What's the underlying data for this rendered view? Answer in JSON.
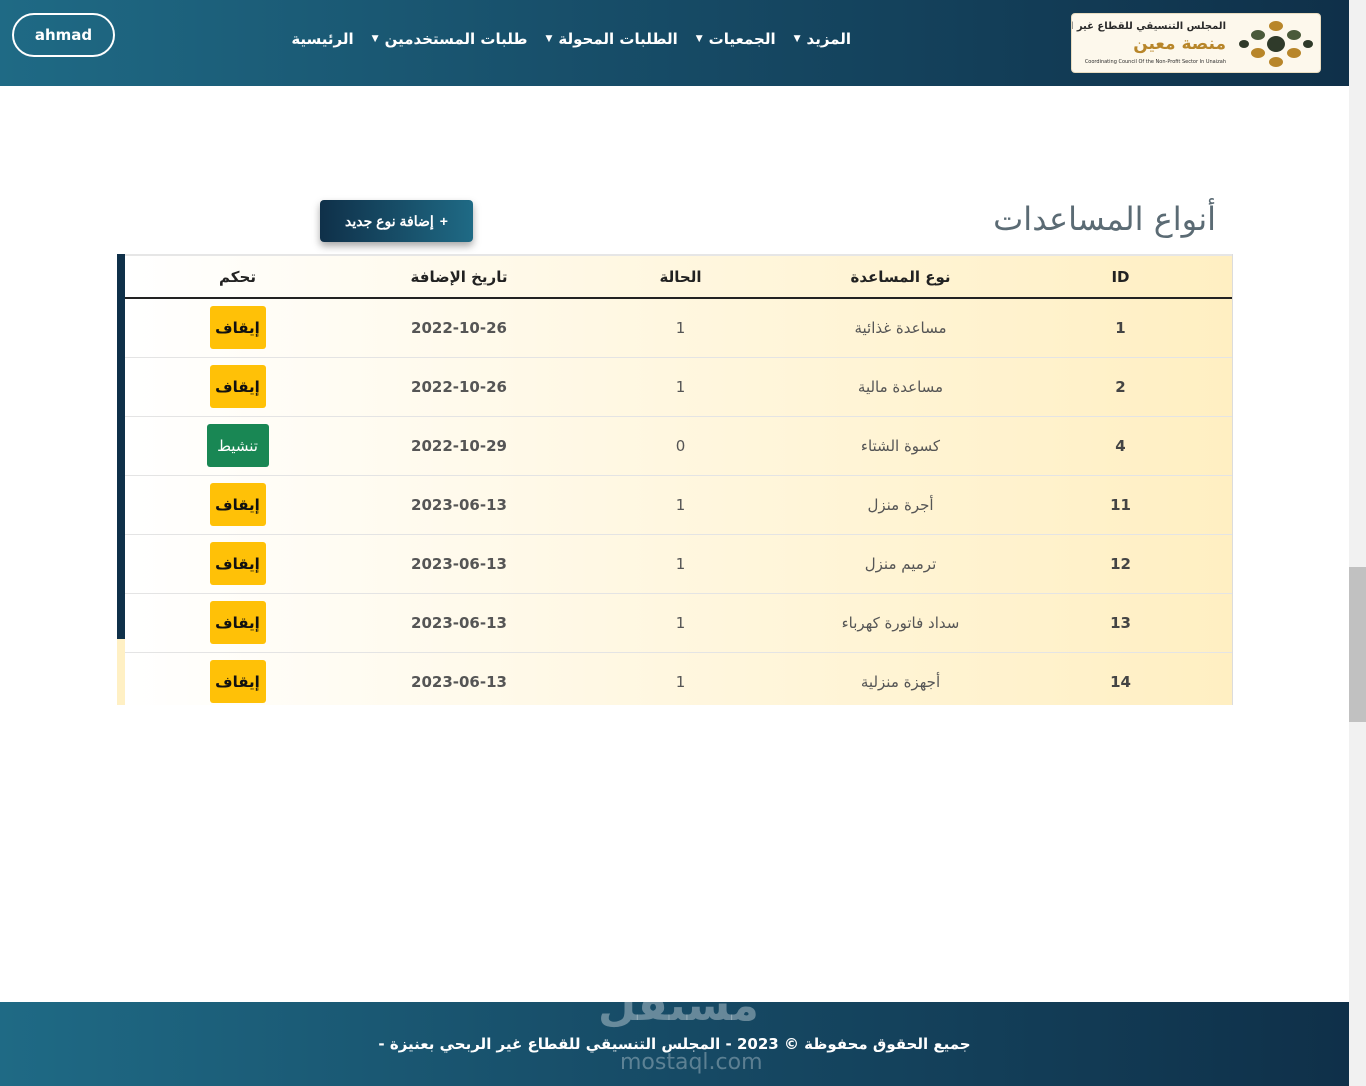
{
  "header": {
    "user_label": "ahmad",
    "nav": [
      {
        "label": "الرئيسية",
        "dropdown": false
      },
      {
        "label": "طلبات المستخدمين",
        "dropdown": true
      },
      {
        "label": "الطلبات المحولة",
        "dropdown": true
      },
      {
        "label": "الجمعيات",
        "dropdown": true
      },
      {
        "label": "المزيد",
        "dropdown": true
      }
    ],
    "logo": {
      "line1": "المجلس التنسيقي للقطاع غير الربحي بعنيزة",
      "line2": "منصة معين",
      "line3": "Coordinating Council Of the Non-Profit Sector In Unaizah"
    }
  },
  "page": {
    "title": "أنواع المساعدات",
    "add_button_icon": "+",
    "add_button_label": "إضافة نوع جديد"
  },
  "table": {
    "headers": {
      "id": "ID",
      "type": "نوع المساعدة",
      "status": "الحالة",
      "date": "تاريخ الإضافة",
      "control": "تحكم"
    },
    "rows": [
      {
        "id": "1",
        "type": "مساعدة غذائية",
        "status": "1",
        "date": "2022-10-26",
        "action": "إيقاف"
      },
      {
        "id": "2",
        "type": "مساعدة مالية",
        "status": "1",
        "date": "2022-10-26",
        "action": "إيقاف"
      },
      {
        "id": "4",
        "type": "كسوة الشتاء",
        "status": "0",
        "date": "2022-10-29",
        "action": "تنشيط"
      },
      {
        "id": "11",
        "type": "أجرة منزل",
        "status": "1",
        "date": "2023-06-13",
        "action": "إيقاف"
      },
      {
        "id": "12",
        "type": "ترميم منزل",
        "status": "1",
        "date": "2023-06-13",
        "action": "إيقاف"
      },
      {
        "id": "13",
        "type": "سداد فاتورة كهرباء",
        "status": "1",
        "date": "2023-06-13",
        "action": "إيقاف"
      },
      {
        "id": "14",
        "type": "أجهزة منزلية",
        "status": "1",
        "date": "2023-06-13",
        "action": "إيقاف"
      }
    ]
  },
  "footer": {
    "text": "جميع الحقوق محفوظة © 2023 - المجلس التنسيقي للقطاع غير الربحي بعنيزة -",
    "watermark": "مستقل",
    "watermark_sub": "mostaql.com"
  },
  "colors": {
    "header_dark": "#0f3049",
    "header_light": "#1f6a85",
    "stop_button": "#ffc107",
    "activate_button": "#198754",
    "table_tint": "#ffefc2"
  }
}
